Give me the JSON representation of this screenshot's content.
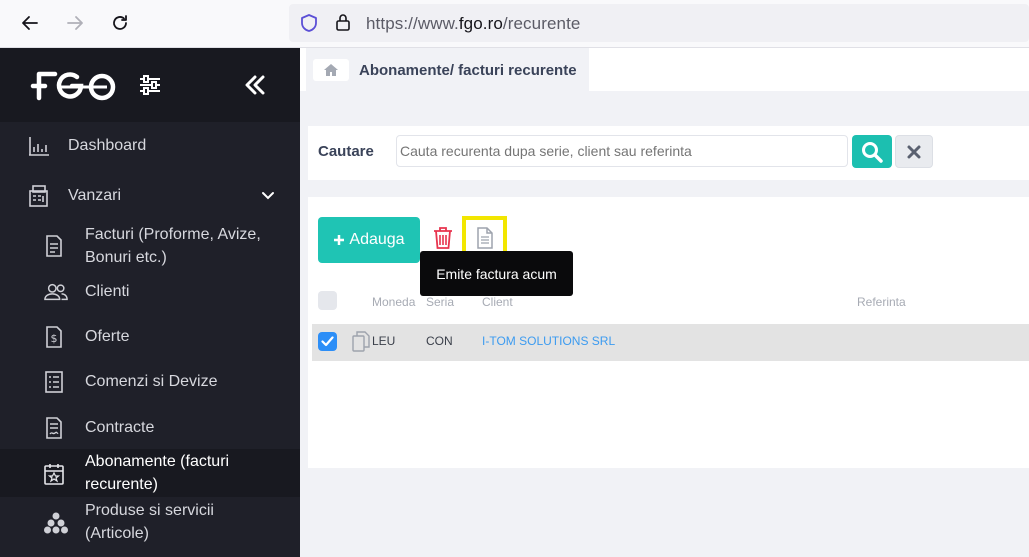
{
  "browser": {
    "url_prefix": "https://www.",
    "url_host": "fgo.ro",
    "url_path": "/recurente"
  },
  "sidebar": {
    "logo": "FGO",
    "items": [
      {
        "label": "Dashboard",
        "icon": "chart-icon"
      },
      {
        "label": "Vanzari",
        "icon": "register-icon"
      },
      {
        "label": "Facturi (Proforme, Avize, Bonuri etc.)",
        "icon": "invoice-icon"
      },
      {
        "label": "Clienti",
        "icon": "users-icon"
      },
      {
        "label": "Oferte",
        "icon": "dollar-doc-icon"
      },
      {
        "label": "Comenzi si Devize",
        "icon": "checklist-icon"
      },
      {
        "label": "Contracte",
        "icon": "contract-icon"
      },
      {
        "label": "Abonamente (facturi recurente)",
        "icon": "calendar-icon"
      },
      {
        "label": "Produse si servicii (Articole)",
        "icon": "products-icon"
      }
    ]
  },
  "breadcrumb": {
    "title": "Abonamente/ facturi recurente"
  },
  "search": {
    "label": "Cautare",
    "placeholder": "Cauta recurenta dupa serie, client sau referinta"
  },
  "toolbar": {
    "add_label": "Adauga",
    "tooltip": "Emite factura acum"
  },
  "table": {
    "headers": [
      "Moneda",
      "Seria",
      "Client",
      "Referinta"
    ],
    "rows": [
      {
        "moneda": "LEU",
        "seria": "CON",
        "client": "I-TOM SOLUTIONS SRL",
        "referinta": ""
      }
    ]
  },
  "colors": {
    "accent": "#1fc4b4",
    "sidebar": "#1f2029",
    "highlight": "#f2e600",
    "link": "#3c9bf0"
  }
}
